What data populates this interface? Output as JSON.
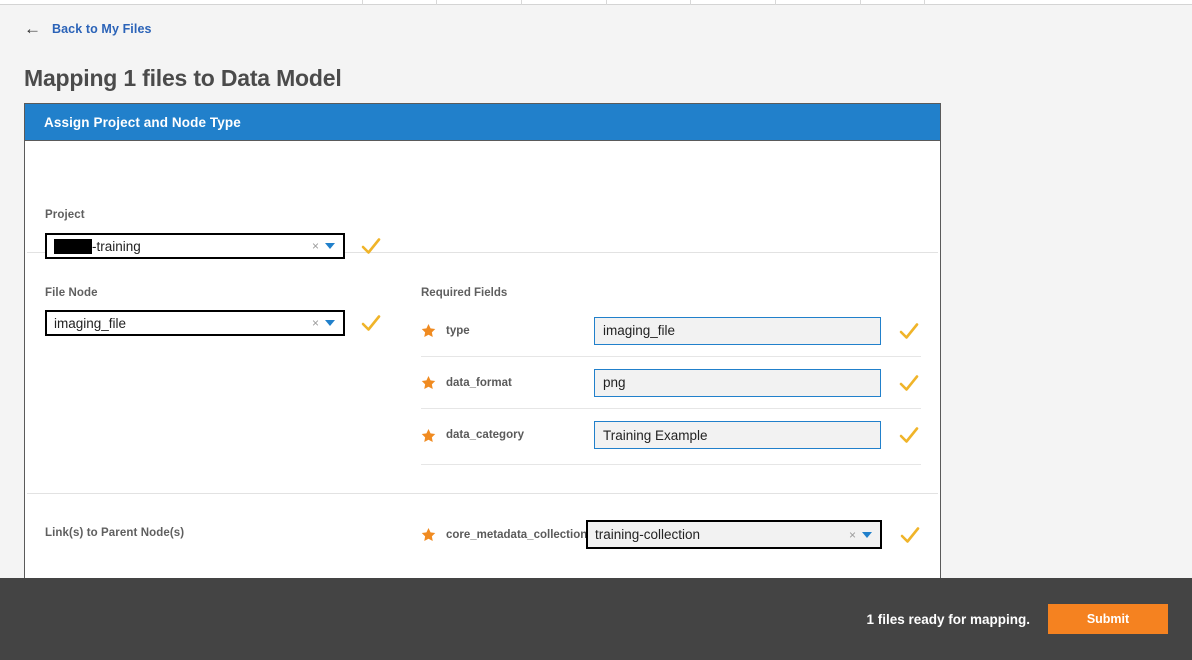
{
  "browser": {
    "tab_separators_x": [
      362,
      436,
      521,
      606,
      690,
      775,
      860,
      924
    ]
  },
  "nav": {
    "back_arrow_icon": "arrow-left-icon",
    "back_label": "Back to My Files"
  },
  "page": {
    "title": "Mapping 1 files to Data Model"
  },
  "card": {
    "header_title": "Assign Project and Node Type",
    "project": {
      "label": "Project",
      "value_redacted": true,
      "value_suffix": "-training",
      "clear_icon": "clear-x-icon",
      "caret_icon": "chevron-down-icon",
      "valid_icon": "checkmark-icon"
    },
    "file_node": {
      "label": "File Node",
      "value": "imaging_file",
      "clear_icon": "clear-x-icon",
      "caret_icon": "chevron-down-icon",
      "valid_icon": "checkmark-icon"
    },
    "required_fields": {
      "title": "Required Fields",
      "rows": [
        {
          "star_icon": "required-star-icon",
          "name": "type",
          "value": "imaging_file",
          "valid_icon": "checkmark-icon"
        },
        {
          "star_icon": "required-star-icon",
          "name": "data_format",
          "value": "png",
          "valid_icon": "checkmark-icon"
        },
        {
          "star_icon": "required-star-icon",
          "name": "data_category",
          "value": "Training Example",
          "valid_icon": "checkmark-icon"
        }
      ]
    },
    "parent_links": {
      "label": "Link(s) to Parent Node(s)",
      "star_icon": "required-star-icon",
      "name": "core_metadata_collection",
      "value": "training-collection",
      "clear_icon": "clear-x-icon",
      "caret_icon": "chevron-down-icon",
      "valid_icon": "checkmark-icon"
    }
  },
  "footer": {
    "status": "1 files ready for mapping.",
    "submit_label": "Submit"
  },
  "colors": {
    "brand_blue": "#2180cb",
    "accent_orange": "#f58220",
    "star_orange": "#f08b21",
    "check_gold": "#f0b429",
    "footer_dark": "#444444",
    "page_bg": "#f4f4f4",
    "link_blue": "#2b63b8"
  }
}
